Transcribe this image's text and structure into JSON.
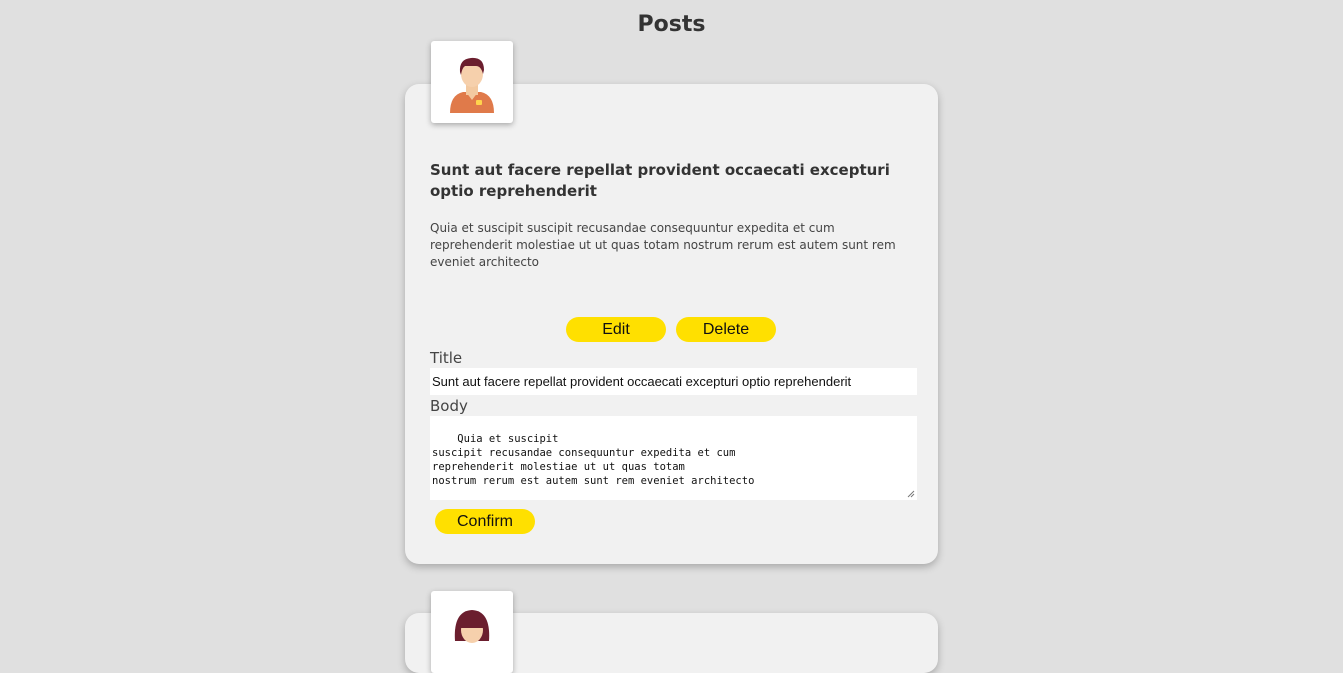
{
  "page": {
    "title": "Posts"
  },
  "posts": [
    {
      "avatar": "male-avatar-icon",
      "title": "Sunt aut facere repellat provident occaecati excepturi optio reprehenderit",
      "body": "Quia et suscipit suscipit recusandae consequuntur expedita et cum reprehenderit molestiae ut ut quas totam nostrum rerum est autem sunt rem eveniet architecto",
      "edit_label": "Edit",
      "delete_label": "Delete",
      "edit_form": {
        "title_label": "Title",
        "title_value": "Sunt aut facere repellat provident occaecati excepturi optio reprehenderit",
        "body_label": "Body",
        "body_value": "Quia et suscipit\nsuscipit recusandae consequuntur expedita et cum\nreprehenderit molestiae ut ut quas totam\nnostrum rerum est autem sunt rem eveniet architecto",
        "confirm_label": "Confirm"
      }
    },
    {
      "avatar": "female-avatar-icon"
    }
  ],
  "colors": {
    "background": "#e0e0e0",
    "card": "#f1f1f1",
    "button": "#ffe000"
  }
}
